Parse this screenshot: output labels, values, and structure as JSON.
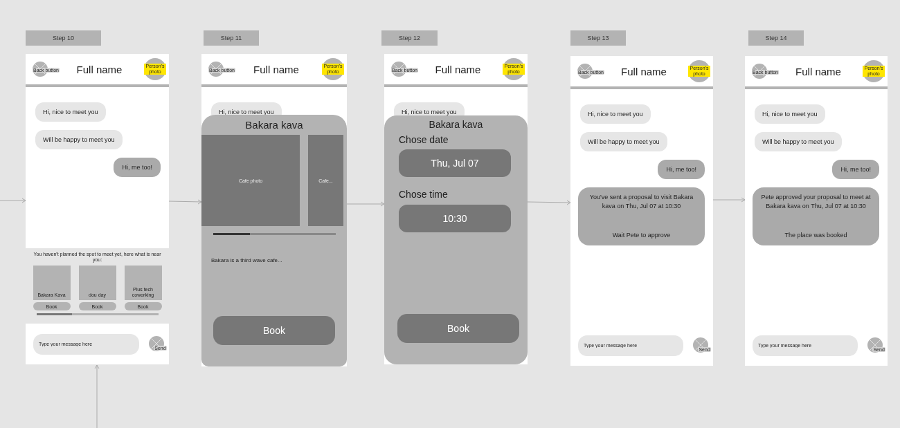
{
  "frames": [
    {
      "step": "Step 10",
      "header": {
        "back": "Back button",
        "title": "Full name",
        "photo": "Person's photo"
      },
      "messages": [
        {
          "kind": "them",
          "text": "Hi, nice to meet you"
        },
        {
          "kind": "them",
          "text": "Will be happy to meet you"
        },
        {
          "kind": "me",
          "text": "Hi, me too!"
        }
      ],
      "suggestions": {
        "text": "You haven't planned the spot to meet yet, here what is near you:",
        "places": [
          {
            "name": "Bakara Kava",
            "button": "Book"
          },
          {
            "name": "dou day",
            "button": "Book"
          },
          {
            "name": "Plus tech coworking",
            "button": "Book"
          }
        ]
      },
      "input": {
        "placeholder": "Type your message here",
        "send": "Send"
      }
    },
    {
      "step": "Step 11",
      "header": {
        "back": "Back button",
        "title": "Full name",
        "photo": "Person's photo"
      },
      "messages": [
        {
          "kind": "them",
          "text": "Hi, nice to meet you"
        }
      ],
      "sheet": {
        "kind": "cafe",
        "title": "Bakara kava",
        "photos": [
          "Cafe photo",
          "Cafe..."
        ],
        "description": "Bakara is a third wave cafe...",
        "button": "Book"
      }
    },
    {
      "step": "Step 12",
      "header": {
        "back": "Back button",
        "title": "Full name",
        "photo": "Person's photo"
      },
      "messages": [
        {
          "kind": "them",
          "text": "Hi, nice to meet you"
        }
      ],
      "sheet": {
        "kind": "datetime",
        "title": "Bakara kava",
        "date_label": "Chose date",
        "date": "Thu, Jul 07",
        "time_label": "Chose time",
        "time": "10:30",
        "button": "Book"
      }
    },
    {
      "step": "Step 13",
      "header": {
        "back": "Back button",
        "title": "Full name",
        "photo": "Person's photo"
      },
      "messages": [
        {
          "kind": "them",
          "text": "Hi, nice to meet you"
        },
        {
          "kind": "them",
          "text": "Will be happy to meet you"
        },
        {
          "kind": "me",
          "text": "Hi, me too!"
        },
        {
          "kind": "system",
          "text": "You've sent a proposal to visit Bakara kava on Thu, Jul 07 at 10:30",
          "note": "Wait Pete to approve"
        }
      ],
      "input": {
        "placeholder": "Type your message here",
        "send": "Send"
      }
    },
    {
      "step": "Step 14",
      "header": {
        "back": "Back button",
        "title": "Full name",
        "photo": "Person's photo"
      },
      "messages": [
        {
          "kind": "them",
          "text": "Hi, nice to meet you"
        },
        {
          "kind": "them",
          "text": "Will be happy to meet you"
        },
        {
          "kind": "me",
          "text": "Hi, me too!"
        },
        {
          "kind": "system",
          "text": "Pete approved your proposal to meet at Bakara kava on Thu, Jul 07 at 10:30",
          "note": "The place was booked"
        }
      ],
      "input": {
        "placeholder": "Type your message here",
        "send": "Send"
      }
    }
  ]
}
